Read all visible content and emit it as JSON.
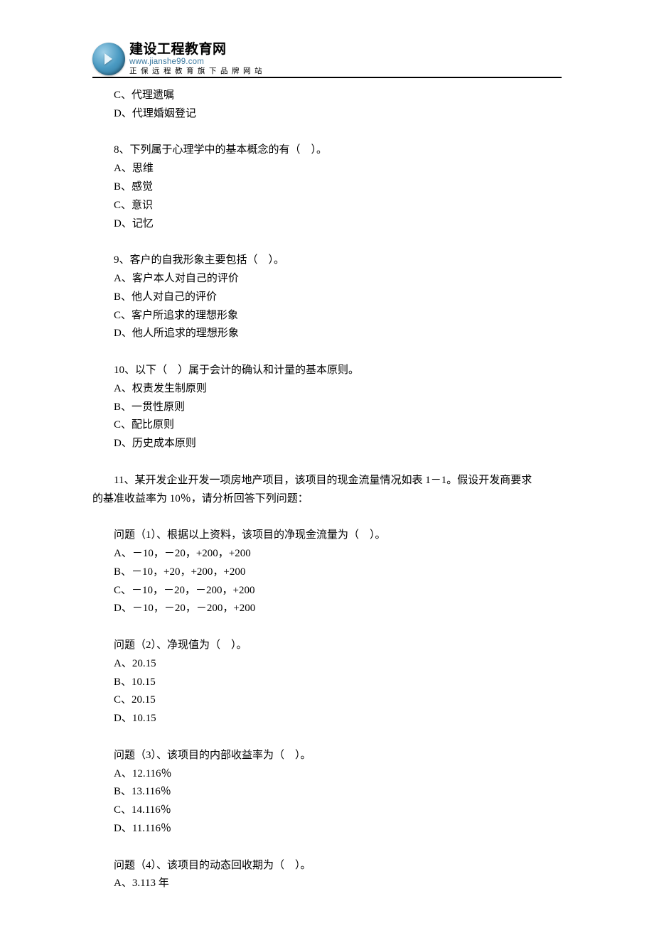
{
  "header": {
    "logo_name": "建设工程教育网",
    "logo_url": "www.jianshe99.com",
    "logo_tagline": "正保远程教育旗下品牌网站"
  },
  "lines": [
    {
      "text": "C、代理遗嘱",
      "cls": "indent"
    },
    {
      "text": "D、代理婚姻登记",
      "cls": "indent"
    },
    {
      "spacer": true
    },
    {
      "text": "8、下列属于心理学中的基本概念的有（　）。",
      "cls": "indent"
    },
    {
      "text": "A、思维",
      "cls": "indent"
    },
    {
      "text": "B、感觉",
      "cls": "indent"
    },
    {
      "text": "C、意识",
      "cls": "indent"
    },
    {
      "text": "D、记忆",
      "cls": "indent"
    },
    {
      "spacer": true
    },
    {
      "text": "9、客户的自我形象主要包括（　）。",
      "cls": "indent"
    },
    {
      "text": "A、客户本人对自己的评价",
      "cls": "indent"
    },
    {
      "text": "B、他人对自己的评价",
      "cls": "indent"
    },
    {
      "text": "C、客户所追求的理想形象",
      "cls": "indent"
    },
    {
      "text": "D、他人所追求的理想形象",
      "cls": "indent"
    },
    {
      "spacer": true
    },
    {
      "text": "10、以下（　）属于会计的确认和计量的基本原则。",
      "cls": "indent"
    },
    {
      "text": "A、权责发生制原则",
      "cls": "indent"
    },
    {
      "text": "B、一贯性原则",
      "cls": "indent"
    },
    {
      "text": "C、配比原则",
      "cls": "indent"
    },
    {
      "text": "D、历史成本原则",
      "cls": "indent"
    },
    {
      "spacer": true
    },
    {
      "text": "11、某开发企业开发一项房地产项目，该项目的现金流量情况如表 1－1。假设开发商要求",
      "cls": "indent"
    },
    {
      "text": "的基准收益率为 10％，请分析回答下列问题：",
      "cls": "noindent"
    },
    {
      "spacer": true
    },
    {
      "text": "问题（1）、根据以上资料，该项目的净现金流量为（　）。",
      "cls": "indent"
    },
    {
      "text": "A、－10，－20，+200，+200",
      "cls": "indent"
    },
    {
      "text": "B、－10，+20，+200，+200",
      "cls": "indent"
    },
    {
      "text": "C、－10，－20，－200，+200",
      "cls": "indent"
    },
    {
      "text": "D、－10，－20，－200，+200",
      "cls": "indent"
    },
    {
      "spacer": true
    },
    {
      "text": "问题（2）、净现值为（　）。",
      "cls": "indent"
    },
    {
      "text": "A、20.15",
      "cls": "indent"
    },
    {
      "text": "B、10.15",
      "cls": "indent"
    },
    {
      "text": "C、20.15",
      "cls": "indent"
    },
    {
      "text": "D、10.15",
      "cls": "indent"
    },
    {
      "spacer": true
    },
    {
      "text": "问题（3）、该项目的内部收益率为（　）。",
      "cls": "indent"
    },
    {
      "text": "A、12.116％",
      "cls": "indent"
    },
    {
      "text": "B、13.116％",
      "cls": "indent"
    },
    {
      "text": "C、14.116％",
      "cls": "indent"
    },
    {
      "text": "D、11.116％",
      "cls": "indent"
    },
    {
      "spacer": true
    },
    {
      "text": "问题（4）、该项目的动态回收期为（　）。",
      "cls": "indent"
    },
    {
      "text": "A、3.113 年",
      "cls": "indent"
    }
  ]
}
